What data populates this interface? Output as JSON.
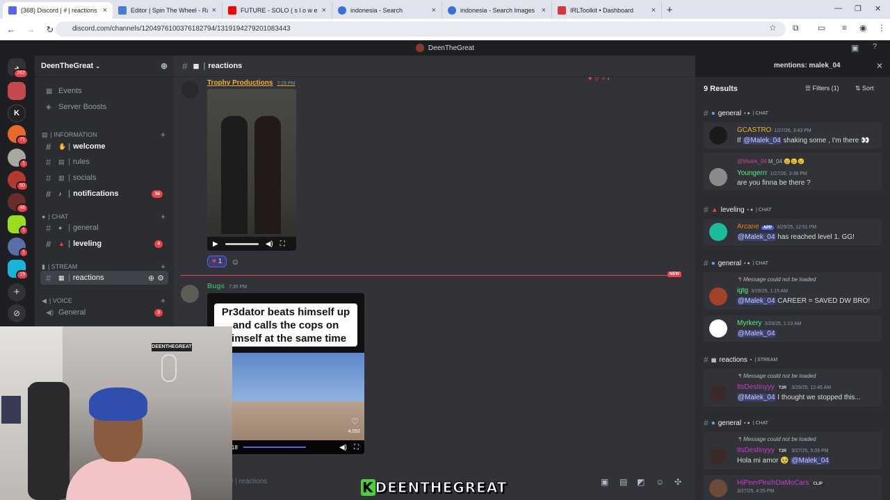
{
  "browser": {
    "tabs": [
      {
        "label": "(368) Discord | # | reactions",
        "color": "#5865f2"
      },
      {
        "label": "Editor | Spin The Wheel - Random",
        "color": "#4a7bd0"
      },
      {
        "label": "FUTURE - SOLO ( s l o w e d",
        "color": "#ff0000"
      },
      {
        "label": "indonesia - Search",
        "color": "#3a6fd8"
      },
      {
        "label": "indonesia - Search Images",
        "color": "#3a6fd8"
      },
      {
        "label": "IRLToolkit • Dashboard",
        "color": "#d9363e"
      }
    ],
    "url": "discord.com/channels/1204976100376182794/1319194279201083443"
  },
  "discord_title": "DeenTheGreat",
  "servers": [
    {
      "badge": "262"
    },
    {
      "badge": ""
    },
    {
      "badge": ""
    },
    {
      "badge": "71"
    },
    {
      "badge": "1"
    },
    {
      "badge": "50"
    },
    {
      "badge": "46"
    },
    {
      "badge": "1"
    },
    {
      "badge": "1"
    },
    {
      "badge": "19"
    }
  ],
  "sidebar": {
    "server_name": "DeenTheGreat",
    "events": "Events",
    "boosts": "Server Boosts",
    "cat_info": "| INFORMATION",
    "cat_chat": "| CHAT",
    "cat_stream": "| STREAM",
    "cat_voice": "| VOICE",
    "channels": {
      "welcome": "welcome",
      "rules": "rules",
      "socials": "socials",
      "notifications": "notifications",
      "notifications_count": "36",
      "general": "general",
      "leveling": "leveling",
      "leveling_count": "4",
      "reactions": "reactions",
      "voice_general": "General",
      "voice_general_count": "3"
    }
  },
  "main": {
    "channel": "reactions",
    "messages": [
      {
        "author": "Trophy Productions",
        "time": "7:29 PM",
        "author_color": "#f0b232"
      },
      {
        "author": "Bugs",
        "time": "7:35 PM",
        "author_color": "#3ba55c"
      }
    ],
    "reaction_count": "1",
    "new_label": "NEW",
    "video_caption": "Pr3dator beats himself up and calls the cops on himself at the same time",
    "video_time": "0:14 / 0:18",
    "video_likes": "4,052",
    "composer": "# | reactions"
  },
  "search": {
    "query": "mentions: malek_04",
    "results_count": "9 Results",
    "filters": "Filters (1)",
    "sort": "Sort",
    "groups": {
      "g1": "general",
      "g1_tag": "| CHAT",
      "g2": "leveling",
      "g2_tag": "| CHAT",
      "g3": "general",
      "g3_tag": "| CHAT",
      "g4": "reactions",
      "g4_tag": "| STREAM",
      "g5": "general",
      "g5_tag": "| CHAT"
    },
    "results": {
      "r1_name": "GCASTRO",
      "r1_time": "1/27/26, 3:43 PM",
      "r1_msg_a": "If",
      "r1_mention": "@Malek_04",
      "r1_msg_b": "shaking some , I'm there 👀",
      "r2_reply": "@Malek_04",
      "r2_reply_tag": "M_04",
      "r2_name": "Youngerrr",
      "r2_time": "1/27/26, 3:39 PM",
      "r2_msg": "are you finna be there ?",
      "r3_name": "Arcane",
      "r3_app": "APP",
      "r3_time": "3/29/25, 12:51 PM",
      "r3_mention": "@Malek_04",
      "r3_msg": "has reached level 1. GG!",
      "r4_reply": "Message could not be loaded",
      "r4_name": "igtg",
      "r4_time": "3/29/25, 1:15 AM",
      "r4_mention": "@Malek_04",
      "r4_msg": "CAREER = SAVED DW BRO!",
      "r5_name": "Myrkery",
      "r5_time": "3/29/25, 1:13 AM",
      "r5_mention": "@Malek_04",
      "r6_reply": "Message could not be loaded",
      "r6_name": "ItsDestinyyy",
      "r6_tag": "T2R",
      "r6_time": "3/29/25, 12:45 AM",
      "r6_mention": "@Malek_04",
      "r6_msg": "I thought we stopped this...",
      "r7_reply": "Message could not be loaded",
      "r7_name": "ItsDestinyyy",
      "r7_tag": "T2R",
      "r7_time": "3/27/25, 5:09 PM",
      "r7_msg": "Hola mi amor 🥹",
      "r7_mention": "@Malek_04",
      "r8_name": "HiPeerPinchDaMoCars",
      "r8_tag": "CLIP",
      "r8_time": "3/27/25, 4:25 PM"
    }
  },
  "overlay": {
    "cam_logo": "DEENTHEGREAT",
    "watermark_k": "K",
    "watermark": "DEENTHEGREAT"
  }
}
